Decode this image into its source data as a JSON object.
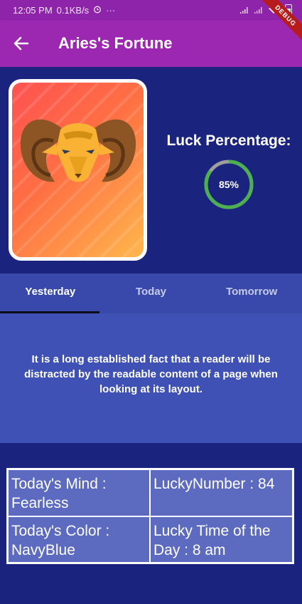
{
  "status_bar": {
    "time": "12:05 PM",
    "speed": "0.1KB/s",
    "dots": "···"
  },
  "app_bar": {
    "title": "Aries's Fortune",
    "back_icon": "arrow-back-icon"
  },
  "debug_banner": "DEBUG",
  "hero": {
    "luck_label": "Luck Percentage:",
    "luck_value_text": "85%",
    "luck_fraction": 0.85
  },
  "tabs": [
    {
      "label": "Yesterday",
      "active": true
    },
    {
      "label": "Today",
      "active": false
    },
    {
      "label": "Tomorrow",
      "active": false
    }
  ],
  "description": "It is a long established fact that a reader will be distracted by the readable content of a page when looking at its layout.",
  "info_table": {
    "mind": "Today's Mind : Fearless",
    "lucky_number": "LuckyNumber : 84",
    "color": "Today's Color : NavyBlue",
    "lucky_time": "Lucky Time of the Day : 8 am"
  },
  "colors": {
    "app_bar": "#9c27b0",
    "background": "#1a237e",
    "tab_bar": "#3949ab",
    "panel": "#3f51b5",
    "table": "#5c6bc0",
    "ring": "#4caf50"
  }
}
